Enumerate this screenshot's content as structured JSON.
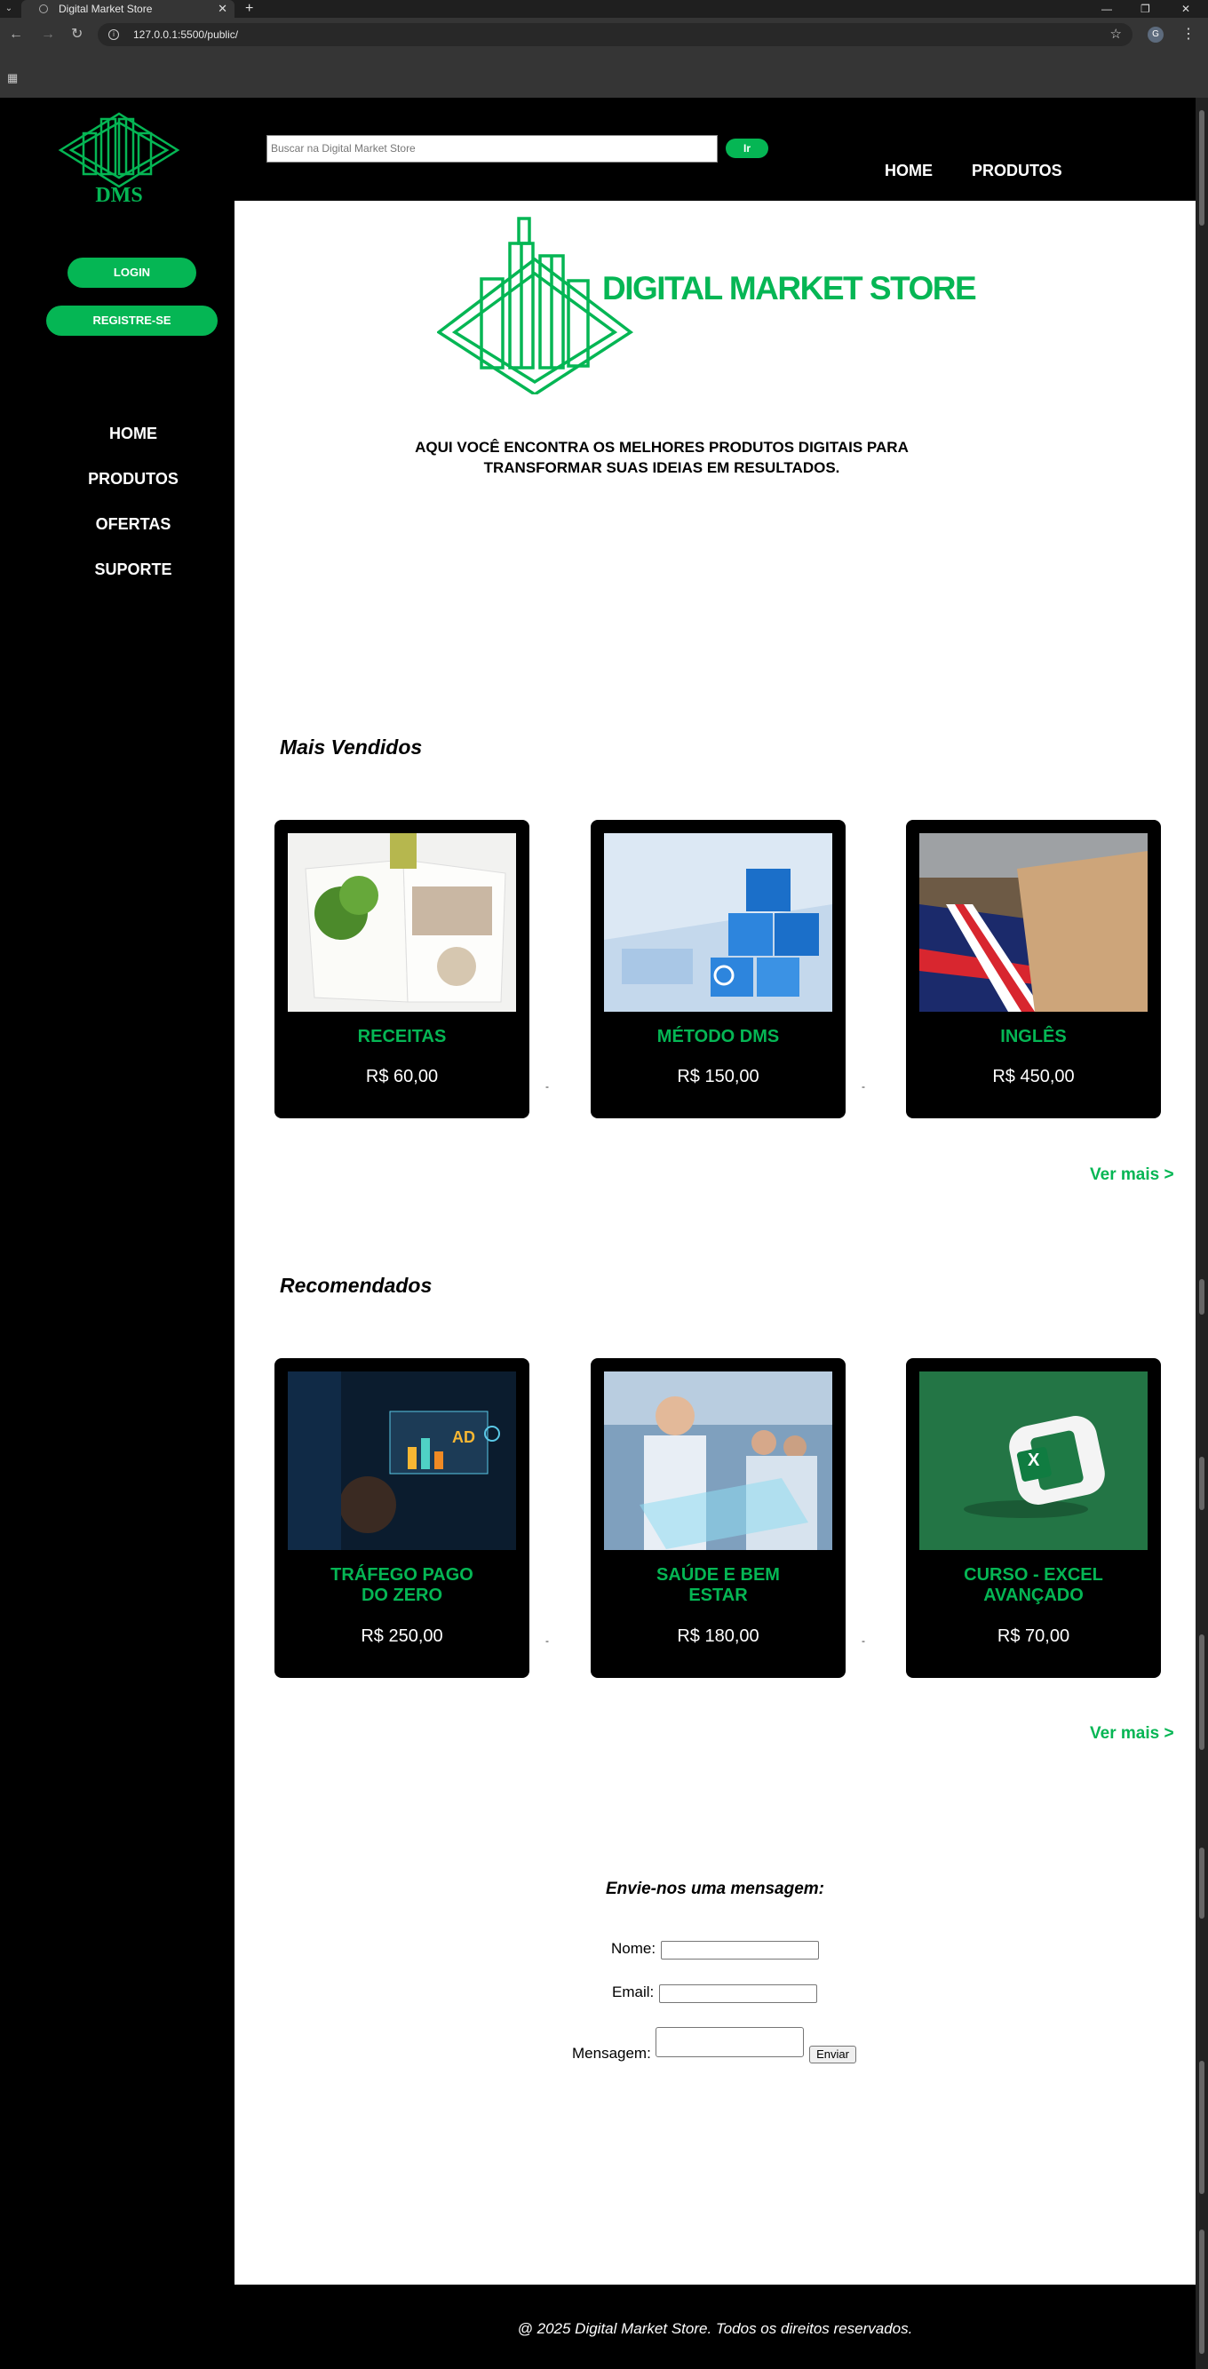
{
  "browser": {
    "tab_title": "Digital Market Store",
    "url": "127.0.0.1:5500/public/",
    "profile_initial": "G"
  },
  "colors": {
    "brand_green": "#05b654",
    "background": "#000000",
    "content_bg": "#ffffff"
  },
  "logo_small_text": "DMS",
  "sidebar": {
    "login_label": "LOGIN",
    "register_label": "REGISTRE-SE",
    "nav": [
      "HOME",
      "PRODUTOS",
      "OFERTAS",
      "SUPORTE"
    ]
  },
  "header": {
    "search_placeholder": "Buscar na Digital Market Store",
    "search_button": "Ir",
    "nav": [
      "HOME",
      "PRODUTOS"
    ]
  },
  "hero": {
    "brand_name": "DIGITAL MARKET STORE",
    "tagline_line1": "AQUI VOCÊ ENCONTRA OS MELHORES PRODUTOS DIGITAIS PARA",
    "tagline_line2": "TRANSFORMAR SUAS IDEIAS EM RESULTADOS."
  },
  "best_sellers": {
    "title": "Mais Vendidos",
    "items": [
      {
        "name": "RECEITAS",
        "price": "R$ 60,00",
        "image": "open-recipe-book-image"
      },
      {
        "name": "MÉTODO DMS",
        "price": "R$ 150,00",
        "image": "business-cubes-image"
      },
      {
        "name": "INGLÊS",
        "price": "R$ 450,00",
        "image": "uk-flag-book-image"
      }
    ],
    "more": "Ver mais >"
  },
  "recommended": {
    "title": "Recomendados",
    "items": [
      {
        "name_line1": "TRÁFEGO PAGO",
        "name_line2": "DO ZERO",
        "price": "R$ 250,00",
        "image": "digital-ads-image"
      },
      {
        "name_line1": "SAÚDE E BEM",
        "name_line2": "ESTAR",
        "price": "R$ 180,00",
        "image": "doctors-hologram-image"
      },
      {
        "name_line1": "CURSO - EXCEL",
        "name_line2": "AVANÇADO",
        "price": "R$ 70,00",
        "image": "excel-icon-image"
      }
    ],
    "more": "Ver mais >"
  },
  "separator": "-",
  "contact": {
    "title": "Envie-nos uma mensagem:",
    "name_label": "Nome:",
    "email_label": "Email:",
    "message_label": "Mensagem:",
    "send_label": "Enviar"
  },
  "footer": {
    "text": "@ 2025 Digital Market Store. Todos os direitos reservados."
  }
}
